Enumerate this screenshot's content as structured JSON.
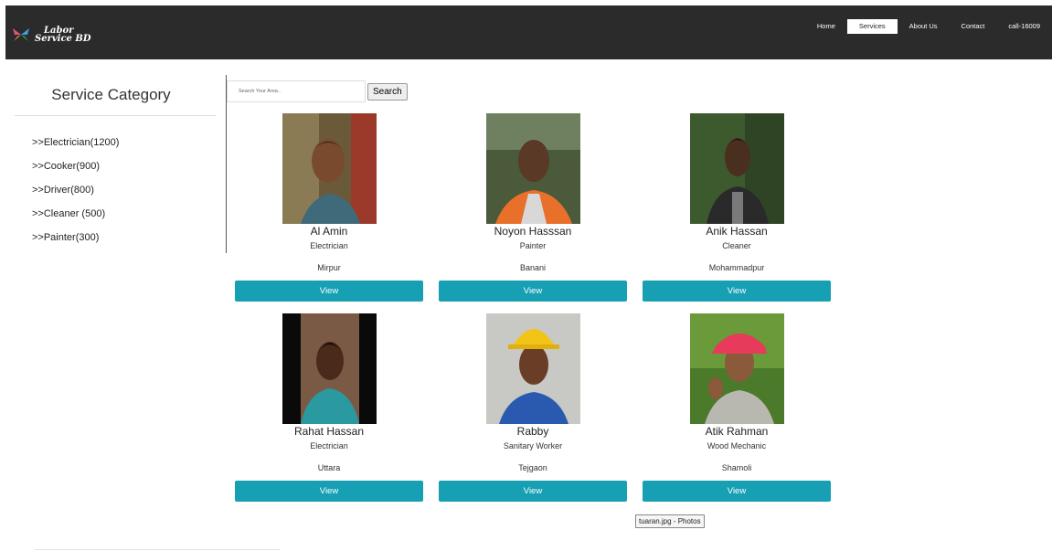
{
  "brand": {
    "line1": "Labor",
    "line2": "Service BD"
  },
  "nav": [
    {
      "label": "Home",
      "active": false
    },
    {
      "label": "Services",
      "active": true
    },
    {
      "label": "About Us",
      "active": false
    },
    {
      "label": "Contact",
      "active": false
    },
    {
      "label": "call-16009",
      "active": false
    }
  ],
  "sidebar": {
    "title": "Service Category",
    "categories": [
      ">>Electrician(1200)",
      ">>Cooker(900)",
      ">>Driver(800)",
      ">>Cleaner (500)",
      ">>Painter(300)"
    ]
  },
  "search": {
    "placeholder": "Search Your Area..",
    "value": "",
    "button": "Search"
  },
  "workers": [
    {
      "name": "Al Amin",
      "job": "Electrician",
      "area": "Mirpur",
      "button": "View"
    },
    {
      "name": "Noyon Hasssan",
      "job": "Painter",
      "area": "Banani",
      "button": "View"
    },
    {
      "name": "Anik Hassan",
      "job": "Cleaner",
      "area": "Mohammadpur",
      "button": "View"
    },
    {
      "name": "Rahat Hassan",
      "job": "Electrician",
      "area": "Uttara",
      "button": "View"
    },
    {
      "name": "Rabby",
      "job": "Sanitary Worker",
      "area": "Tejgaon",
      "button": "View"
    },
    {
      "name": "Atik Rahman",
      "job": "Wood Mechanic",
      "area": "Shamoli",
      "button": "View"
    }
  ],
  "tooltip": "tuaran.jpg - Photos",
  "colors": {
    "navbar": "#2b2b2b",
    "button": "#17a0b4"
  }
}
